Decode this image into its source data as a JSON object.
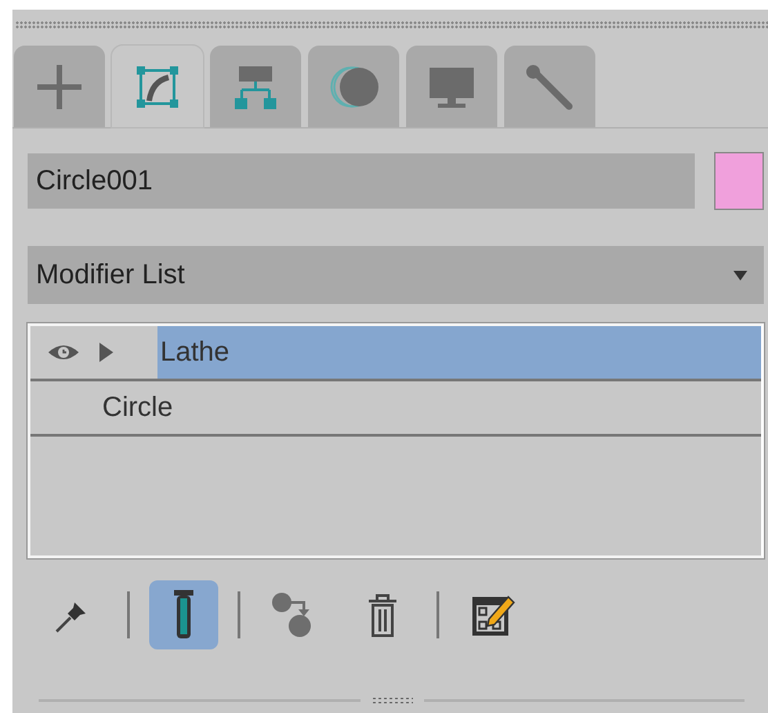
{
  "tabs": [
    {
      "kind": "create",
      "selected": false
    },
    {
      "kind": "modify",
      "selected": true
    },
    {
      "kind": "hierarchy",
      "selected": false
    },
    {
      "kind": "motion",
      "selected": false
    },
    {
      "kind": "display",
      "selected": false
    },
    {
      "kind": "utilities",
      "selected": false
    }
  ],
  "object_name": {
    "value": "Circle001"
  },
  "object_color": {
    "color": "#f0a0dc"
  },
  "modifier_list": {
    "label": "Modifier List"
  },
  "stack": [
    {
      "label": "Lathe",
      "kind": "modifier",
      "selected": true
    },
    {
      "label": "Circle",
      "kind": "base",
      "selected": false
    }
  ],
  "toolbar": [
    {
      "kind": "pin",
      "on": false
    },
    {
      "kind": "separator"
    },
    {
      "kind": "show-end-result",
      "on": true
    },
    {
      "kind": "separator"
    },
    {
      "kind": "make-unique",
      "on": false
    },
    {
      "kind": "remove",
      "on": false
    },
    {
      "kind": "separator"
    },
    {
      "kind": "configure",
      "on": false
    }
  ]
}
